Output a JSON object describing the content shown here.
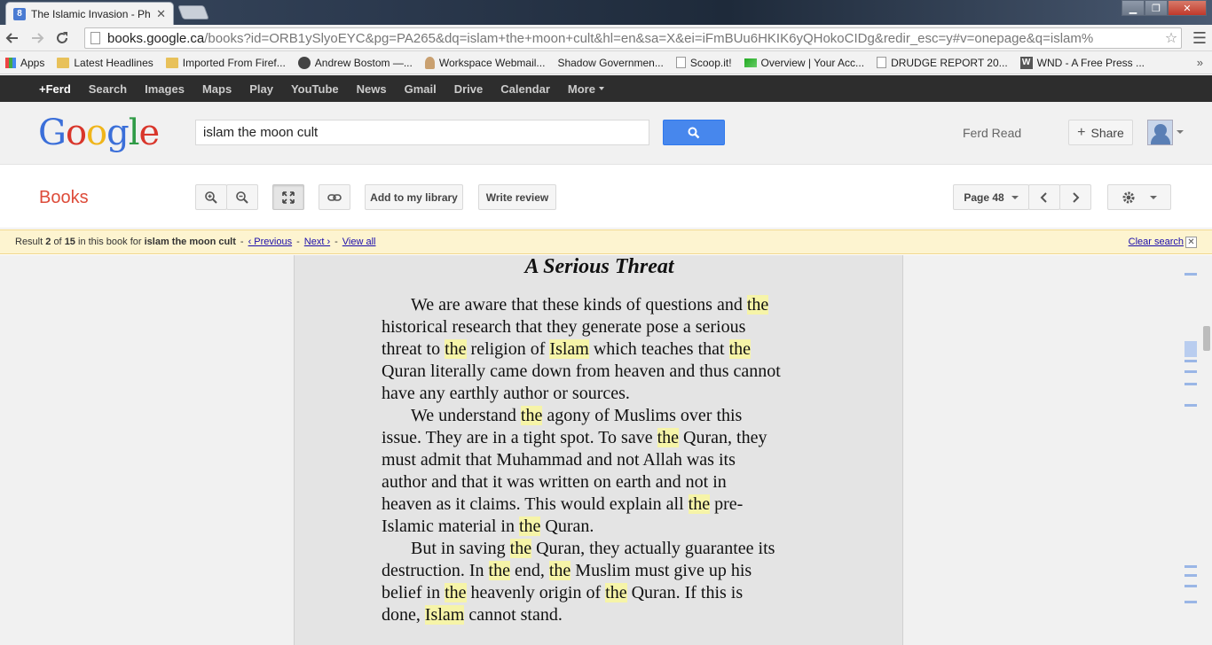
{
  "browser": {
    "tab_title": "The Islamic Invasion - Ph",
    "tab_favicon": "8",
    "url_host": "books.google.ca",
    "url_path": "/books?id=ORB1ySlyoEYC&pg=PA265&dq=islam+the+moon+cult&hl=en&sa=X&ei=iFmBUu6HKIK6yQHokoCIDg&redir_esc=y#v=onepage&q=islam%",
    "bookmarks": [
      {
        "label": "Apps",
        "icon": "apps"
      },
      {
        "label": "Latest Headlines",
        "icon": "folder"
      },
      {
        "label": "Imported From Firef...",
        "icon": "folder"
      },
      {
        "label": "Andrew Bostom —...",
        "icon": "wp"
      },
      {
        "label": "Workspace Webmail...",
        "icon": "person"
      },
      {
        "label": "Shadow Governmen...",
        "icon": "none"
      },
      {
        "label": "Scoop.it!",
        "icon": "page"
      },
      {
        "label": "Overview | Your Acc...",
        "icon": "green"
      },
      {
        "label": "DRUDGE REPORT 20...",
        "icon": "page"
      },
      {
        "label": "WND - A Free Press ...",
        "icon": "wnd"
      }
    ],
    "bookmarks_more": "»"
  },
  "gbar": {
    "items": [
      "+Ferd",
      "Search",
      "Images",
      "Maps",
      "Play",
      "YouTube",
      "News",
      "Gmail",
      "Drive",
      "Calendar",
      "More"
    ]
  },
  "header": {
    "logo_letters": [
      "G",
      "o",
      "o",
      "g",
      "l",
      "e"
    ],
    "search_value": "islam the moon cult",
    "user_name": "Ferd Read",
    "share_label": "Share"
  },
  "books_toolbar": {
    "title": "Books",
    "add_library": "Add to my library",
    "write_review": "Write review",
    "page_label": "Page 48"
  },
  "result_bar": {
    "prefix": "Result",
    "current": "2",
    "of": "of",
    "total": "15",
    "mid": "in this book for",
    "query": "islam the moon cult",
    "dash": "-",
    "previous": "‹ Previous",
    "next": "Next ›",
    "view_all": "View all",
    "clear": "Clear search"
  },
  "page": {
    "heading": "A Serious Threat",
    "lines": [
      {
        "indent": true,
        "parts": [
          [
            "We are aware that these kinds of questions and ",
            false
          ],
          [
            "the",
            true
          ]
        ]
      },
      {
        "indent": false,
        "parts": [
          [
            "historical research that they generate pose a serious",
            false
          ]
        ]
      },
      {
        "indent": false,
        "parts": [
          [
            "threat to ",
            false
          ],
          [
            "the",
            true
          ],
          [
            " religion of ",
            false
          ],
          [
            "Islam",
            true
          ],
          [
            " which teaches that ",
            false
          ],
          [
            "the",
            true
          ]
        ]
      },
      {
        "indent": false,
        "parts": [
          [
            "Quran literally came down from heaven and thus cannot",
            false
          ]
        ]
      },
      {
        "indent": false,
        "parts": [
          [
            "have any earthly author or sources.",
            false
          ]
        ]
      },
      {
        "indent": true,
        "parts": [
          [
            "We understand ",
            false
          ],
          [
            "the",
            true
          ],
          [
            " agony of Muslims over this",
            false
          ]
        ]
      },
      {
        "indent": false,
        "parts": [
          [
            "issue. They are in a tight spot. To save ",
            false
          ],
          [
            "the",
            true
          ],
          [
            " Quran, they",
            false
          ]
        ]
      },
      {
        "indent": false,
        "parts": [
          [
            "must admit that Muhammad and not Allah was its",
            false
          ]
        ]
      },
      {
        "indent": false,
        "parts": [
          [
            "author and that it was written on earth and not in",
            false
          ]
        ]
      },
      {
        "indent": false,
        "parts": [
          [
            "heaven as it claims. This would explain all ",
            false
          ],
          [
            "the",
            true
          ],
          [
            " pre-",
            false
          ]
        ]
      },
      {
        "indent": false,
        "parts": [
          [
            "Islamic material in ",
            false
          ],
          [
            "the",
            true
          ],
          [
            " Quran.",
            false
          ]
        ]
      },
      {
        "indent": true,
        "parts": [
          [
            "But in saving ",
            false
          ],
          [
            "the",
            true
          ],
          [
            " Quran, they actually guarantee its",
            false
          ]
        ]
      },
      {
        "indent": false,
        "parts": [
          [
            "destruction. In ",
            false
          ],
          [
            "the",
            true
          ],
          [
            " end, ",
            false
          ],
          [
            "the",
            true
          ],
          [
            " Muslim must give up his",
            false
          ]
        ]
      },
      {
        "indent": false,
        "parts": [
          [
            "belief in ",
            false
          ],
          [
            "the",
            true
          ],
          [
            " heavenly origin of ",
            false
          ],
          [
            "the",
            true
          ],
          [
            " Quran. If this is",
            false
          ]
        ]
      },
      {
        "indent": false,
        "parts": [
          [
            "done, ",
            false
          ],
          [
            "Islam",
            true
          ],
          [
            " cannot stand.",
            false
          ]
        ]
      }
    ]
  },
  "colors": {
    "highlight": "#f6f4a8",
    "books_red": "#dd4b39",
    "search_blue": "#4787ed",
    "result_bar_bg": "#fdf4d0"
  }
}
